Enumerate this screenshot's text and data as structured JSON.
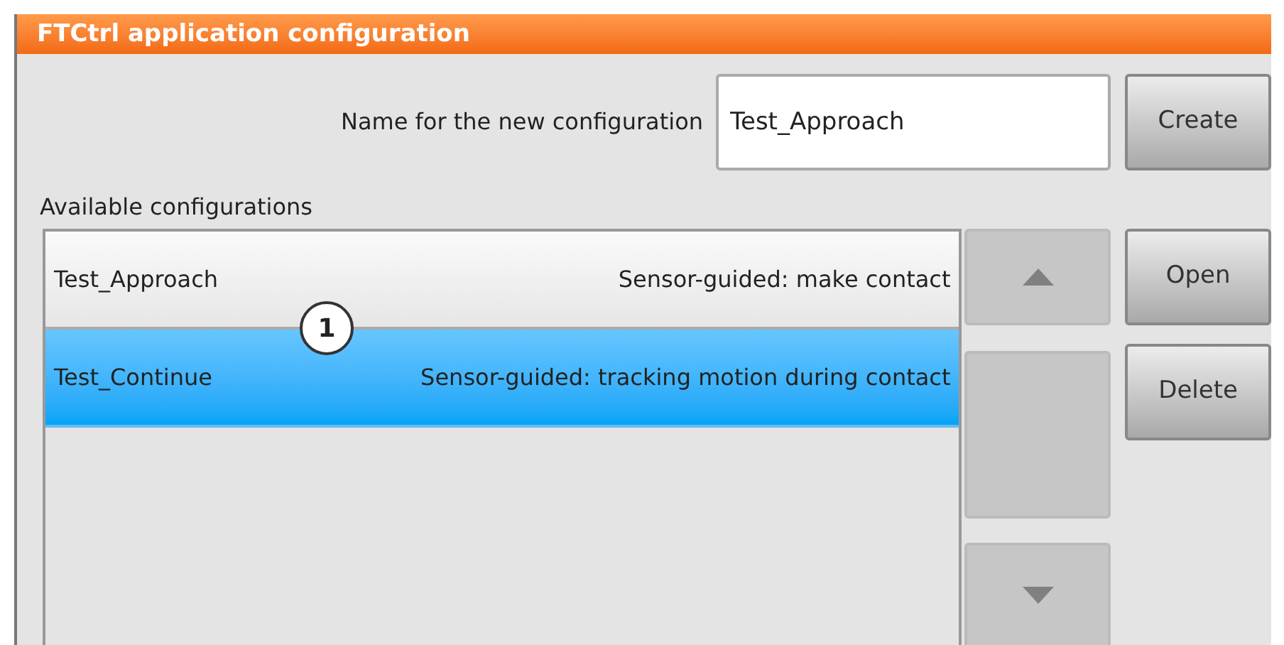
{
  "window": {
    "title": "FTCtrl application configuration"
  },
  "new_config": {
    "label": "Name for the new configuration",
    "value": "Test_Approach",
    "button": "Create"
  },
  "list_label": "Available configurations",
  "configurations": [
    {
      "name": "Test_Approach",
      "description": "Sensor-guided: make contact",
      "selected": false
    },
    {
      "name": "Test_Continue",
      "description": "Sensor-guided: tracking motion during contact",
      "selected": true
    }
  ],
  "buttons": [
    "Open",
    "Delete"
  ],
  "callout": "1"
}
